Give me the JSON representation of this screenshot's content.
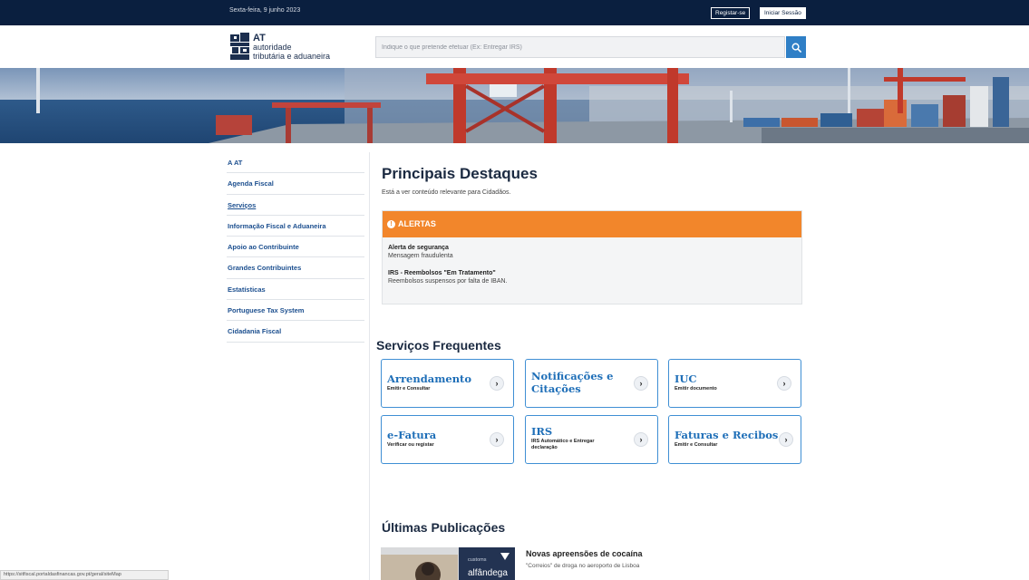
{
  "topbar": {
    "date": "Sexta-feira, 9 junho 2023",
    "register_label": "Registar-se",
    "login_label": "Iniciar Sessão"
  },
  "header": {
    "logo_line1": "AT",
    "logo_line2": "autoridade",
    "logo_line3": "tributária e aduaneira",
    "search_placeholder": "Indique o que pretende efetuar (Ex: Entregar IRS)"
  },
  "sidebar": {
    "items": [
      {
        "label": "A AT"
      },
      {
        "label": "Agenda Fiscal"
      },
      {
        "label": "Serviços"
      },
      {
        "label": "Informação Fiscal e Aduaneira"
      },
      {
        "label": "Apoio ao Contribuinte"
      },
      {
        "label": "Grandes Contribuintes"
      },
      {
        "label": "Estatísticas"
      },
      {
        "label": "Portuguese Tax System"
      },
      {
        "label": "Cidadania Fiscal"
      }
    ]
  },
  "main": {
    "title": "Principais Destaques",
    "subtitle": "Está a ver conteúdo relevante para Cidadãos.",
    "alerts": {
      "header": "ALERTAS",
      "items": [
        {
          "title": "Alerta de segurança",
          "desc": "Mensagem fraudulenta"
        },
        {
          "title": "IRS - Reembolsos \"Em Tratamento\"",
          "desc": "Reembolsos suspensos por falta de IBAN."
        }
      ]
    },
    "services": {
      "title": "Serviços Frequentes",
      "cards": [
        {
          "title": "Arrendamento",
          "desc": "Emitir e Consultar"
        },
        {
          "title1": "Notificações e",
          "title2": "Citações"
        },
        {
          "title": "IUC",
          "desc": "Emitir documento"
        },
        {
          "title": "e-Fatura",
          "desc": "Verificar ou registar"
        },
        {
          "title": "IRS",
          "desc1": "IRS Automático e Entregar",
          "desc2": "declaração"
        },
        {
          "title": "Faturas e Recibos",
          "desc": "Emitir e Consultar"
        }
      ]
    },
    "publications": {
      "title": "Últimas Publicações",
      "image_text1": "customs",
      "image_text2": "alfândega",
      "items": [
        {
          "title": "Novas apreensões de cocaína",
          "desc": "\"Correios\" de droga no aeroporto de Lisboa"
        }
      ]
    }
  },
  "statusbar": {
    "url": "https://sitfiscal.portaldasfinancas.gov.pt/geral/siteMap"
  },
  "colors": {
    "topbar": "#0a1f3f",
    "accent": "#2f7fc6",
    "alert": "#f2862b",
    "link": "#1c4f8f"
  }
}
